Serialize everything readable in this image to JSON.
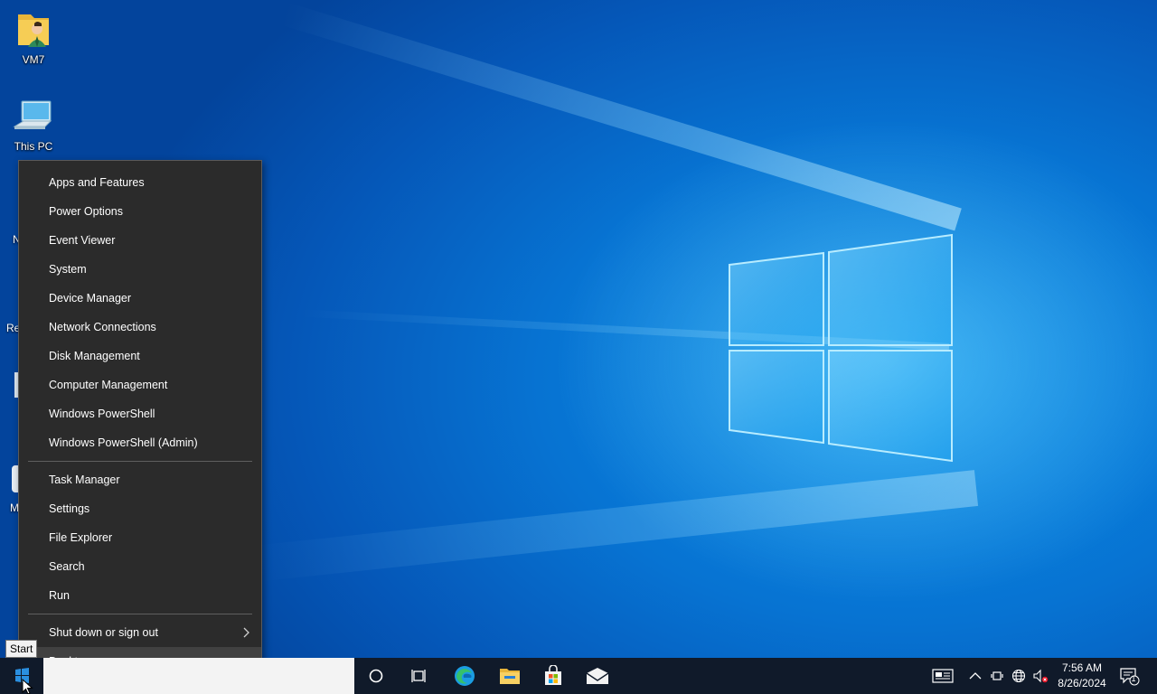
{
  "desktop_icons": [
    {
      "label": "VM7",
      "icon": "user-folder-icon"
    },
    {
      "label": "This PC",
      "icon": "computer-icon"
    }
  ],
  "partial_labels": [
    "N",
    "Re",
    "M"
  ],
  "menu": {
    "group1": [
      "Apps and Features",
      "Power Options",
      "Event Viewer",
      "System",
      "Device Manager",
      "Network Connections",
      "Disk Management",
      "Computer Management",
      "Windows PowerShell",
      "Windows PowerShell (Admin)"
    ],
    "group2": [
      "Task Manager",
      "Settings",
      "File Explorer",
      "Search",
      "Run"
    ],
    "group3": [
      "Shut down or sign out",
      "Desktop"
    ]
  },
  "tooltip": "Start",
  "taskbar": {
    "apps": [
      "cortana-circle-icon",
      "task-view-icon",
      "edge-icon",
      "file-explorer-icon",
      "store-icon",
      "mail-icon"
    ],
    "tray": [
      "news-icon",
      "chevron-up-icon",
      "meet-now-icon",
      "network-icon",
      "volume-muted-icon"
    ],
    "time": "7:56 AM",
    "date": "8/26/2024",
    "notification_count": "1"
  },
  "colors": {
    "menu_bg": "#2b2b2b",
    "menu_hover": "#414141",
    "taskbar_bg": "#101a2a",
    "wallpaper_accent": "#0a8ce8"
  }
}
